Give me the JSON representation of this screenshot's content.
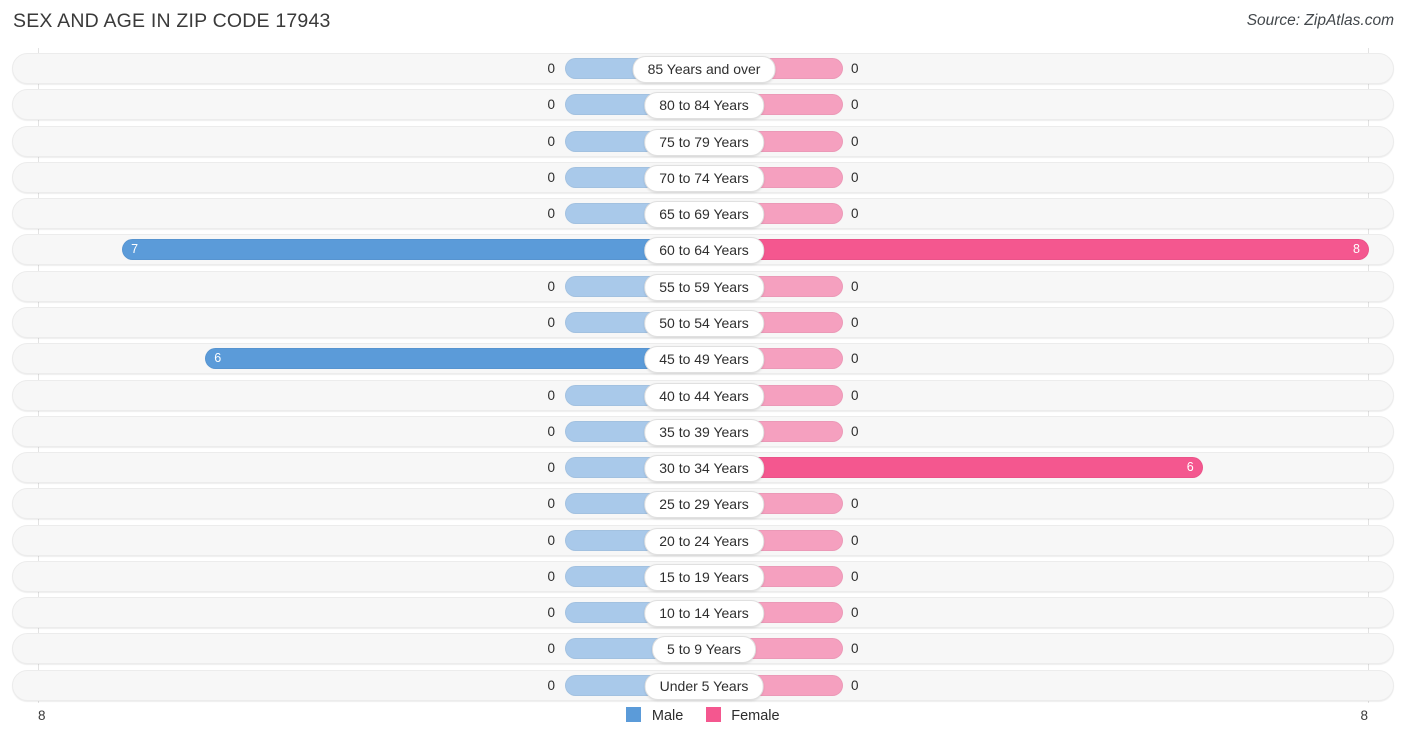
{
  "header": {
    "title": "SEX AND AGE IN ZIP CODE 17943",
    "source": "Source: ZipAtlas.com"
  },
  "legend": {
    "male_label": "Male",
    "female_label": "Female",
    "male_color": "#5b9bd9",
    "female_color": "#f4578f"
  },
  "axis": {
    "left_tick": "8",
    "right_tick": "8"
  },
  "chart_data": {
    "type": "bar",
    "subtype": "population-pyramid",
    "title": "SEX AND AGE IN ZIP CODE 17943",
    "xlabel": "",
    "ylabel": "",
    "xlim": [
      8,
      8
    ],
    "grid": false,
    "legend_position": "bottom-center",
    "categories": [
      "85 Years and over",
      "80 to 84 Years",
      "75 to 79 Years",
      "70 to 74 Years",
      "65 to 69 Years",
      "60 to 64 Years",
      "55 to 59 Years",
      "50 to 54 Years",
      "45 to 49 Years",
      "40 to 44 Years",
      "35 to 39 Years",
      "30 to 34 Years",
      "25 to 29 Years",
      "20 to 24 Years",
      "15 to 19 Years",
      "10 to 14 Years",
      "5 to 9 Years",
      "Under 5 Years"
    ],
    "series": [
      {
        "name": "Male",
        "color": "#5b9bd9",
        "values": [
          0,
          0,
          0,
          0,
          0,
          7,
          0,
          0,
          6,
          0,
          0,
          0,
          0,
          0,
          0,
          0,
          0,
          0
        ]
      },
      {
        "name": "Female",
        "color": "#f4578f",
        "values": [
          0,
          0,
          0,
          0,
          0,
          8,
          0,
          0,
          0,
          0,
          0,
          6,
          0,
          0,
          0,
          0,
          0,
          0
        ]
      }
    ]
  },
  "rows": [
    {
      "label": "85 Years and over",
      "male": 0,
      "female": 0,
      "male_text": "0",
      "female_text": "0"
    },
    {
      "label": "80 to 84 Years",
      "male": 0,
      "female": 0,
      "male_text": "0",
      "female_text": "0"
    },
    {
      "label": "75 to 79 Years",
      "male": 0,
      "female": 0,
      "male_text": "0",
      "female_text": "0"
    },
    {
      "label": "70 to 74 Years",
      "male": 0,
      "female": 0,
      "male_text": "0",
      "female_text": "0"
    },
    {
      "label": "65 to 69 Years",
      "male": 0,
      "female": 0,
      "male_text": "0",
      "female_text": "0"
    },
    {
      "label": "60 to 64 Years",
      "male": 7,
      "female": 8,
      "male_text": "7",
      "female_text": "8"
    },
    {
      "label": "55 to 59 Years",
      "male": 0,
      "female": 0,
      "male_text": "0",
      "female_text": "0"
    },
    {
      "label": "50 to 54 Years",
      "male": 0,
      "female": 0,
      "male_text": "0",
      "female_text": "0"
    },
    {
      "label": "45 to 49 Years",
      "male": 6,
      "female": 0,
      "male_text": "6",
      "female_text": "0"
    },
    {
      "label": "40 to 44 Years",
      "male": 0,
      "female": 0,
      "male_text": "0",
      "female_text": "0"
    },
    {
      "label": "35 to 39 Years",
      "male": 0,
      "female": 0,
      "male_text": "0",
      "female_text": "0"
    },
    {
      "label": "30 to 34 Years",
      "male": 0,
      "female": 6,
      "male_text": "0",
      "female_text": "6"
    },
    {
      "label": "25 to 29 Years",
      "male": 0,
      "female": 0,
      "male_text": "0",
      "female_text": "0"
    },
    {
      "label": "20 to 24 Years",
      "male": 0,
      "female": 0,
      "male_text": "0",
      "female_text": "0"
    },
    {
      "label": "15 to 19 Years",
      "male": 0,
      "female": 0,
      "male_text": "0",
      "female_text": "0"
    },
    {
      "label": "10 to 14 Years",
      "male": 0,
      "female": 0,
      "male_text": "0",
      "female_text": "0"
    },
    {
      "label": "5 to 9 Years",
      "male": 0,
      "female": 0,
      "male_text": "0",
      "female_text": "0"
    },
    {
      "label": "Under 5 Years",
      "male": 0,
      "female": 0,
      "male_text": "0",
      "female_text": "0"
    }
  ]
}
